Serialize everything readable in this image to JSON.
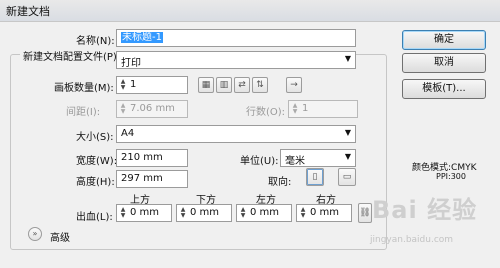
{
  "window": {
    "title": "新建文档"
  },
  "name": {
    "label": "名称(N):",
    "value": "未标题-1"
  },
  "profile": {
    "label": "新建文档配置文件(P):",
    "value": "打印"
  },
  "artboards": {
    "count_label": "画板数量(M):",
    "count_value": "1",
    "spacing_label": "间距(I):",
    "spacing_value": "7.06 mm",
    "rows_label": "行数(O):",
    "rows_value": "1"
  },
  "size": {
    "label": "大小(S):",
    "value": "A4"
  },
  "width": {
    "label": "宽度(W):",
    "value": "210 mm"
  },
  "height": {
    "label": "高度(H):",
    "value": "297 mm"
  },
  "units": {
    "label": "单位(U):",
    "value": "毫米"
  },
  "orientation": {
    "label": "取向:"
  },
  "bleed": {
    "label": "出血(L):",
    "top_label": "上方",
    "top_value": "0 mm",
    "bottom_label": "下方",
    "bottom_value": "0 mm",
    "left_label": "左方",
    "left_value": "0 mm",
    "right_label": "右方",
    "right_value": "0 mm"
  },
  "advanced": {
    "label": "高级"
  },
  "buttons": {
    "ok": "确定",
    "cancel": "取消",
    "templates": "模板(T)..."
  },
  "color_info": {
    "mode": "颜色模式:CMYK",
    "ppi": "PPI:300"
  },
  "watermark": {
    "text": "Bai 经验",
    "url": "jingyan.baidu.com"
  },
  "colors": {
    "selection": "#3399ff",
    "dialog_bg": "#f0f0f0"
  }
}
